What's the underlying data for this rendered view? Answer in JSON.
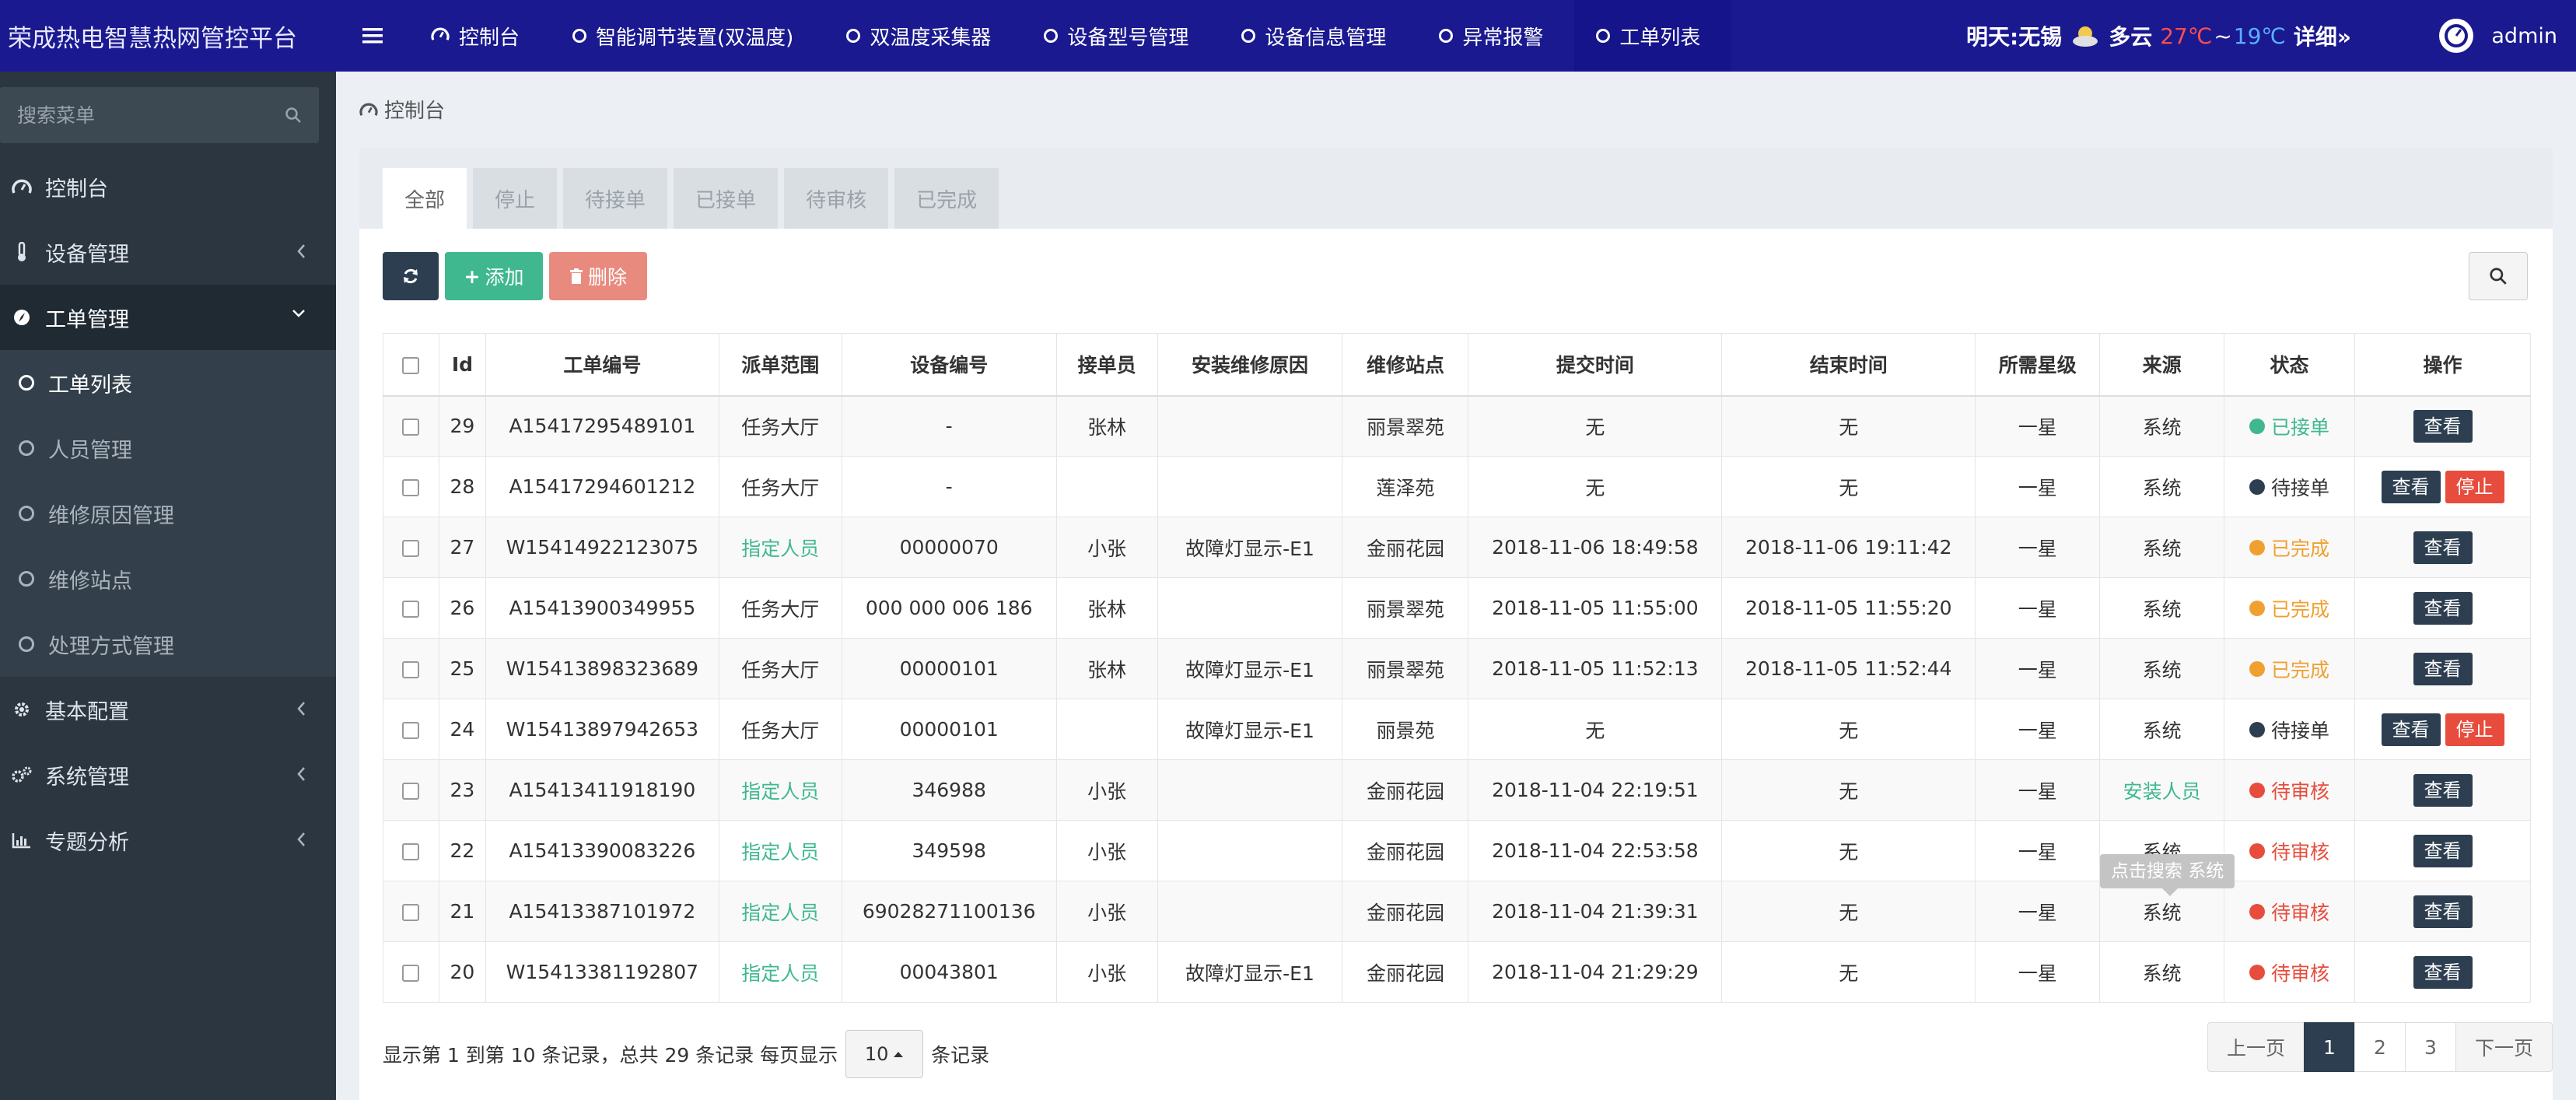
{
  "app": {
    "title": "荣成热电智慧热网管控平台"
  },
  "topnav": [
    {
      "label": "控制台",
      "icon": "dashboard-icon"
    },
    {
      "label": "智能调节装置(双温度)",
      "icon": "circle-icon"
    },
    {
      "label": "双温度采集器",
      "icon": "circle-icon"
    },
    {
      "label": "设备型号管理",
      "icon": "circle-icon"
    },
    {
      "label": "设备信息管理",
      "icon": "circle-icon"
    },
    {
      "label": "异常报警",
      "icon": "circle-icon"
    },
    {
      "label": "工单列表",
      "icon": "circle-icon"
    }
  ],
  "weather": {
    "prefix": "明天:",
    "city": "无锡",
    "condition": "多云",
    "high": "27℃",
    "tilde": "~",
    "low": "19℃",
    "detail": "详细»"
  },
  "user": {
    "name": "admin"
  },
  "sidebar": {
    "search_placeholder": "搜索菜单",
    "items": [
      {
        "label": "控制台",
        "icon": "dashboard-icon"
      },
      {
        "label": "设备管理",
        "icon": "thermometer-icon"
      },
      {
        "label": "工单管理",
        "icon": "compass-icon"
      },
      {
        "label": "基本配置",
        "icon": "gear-icon"
      },
      {
        "label": "系统管理",
        "icon": "cogs-icon"
      },
      {
        "label": "专题分析",
        "icon": "bar-chart-icon"
      }
    ],
    "subitems": [
      {
        "label": "工单列表"
      },
      {
        "label": "人员管理"
      },
      {
        "label": "维修原因管理"
      },
      {
        "label": "维修站点"
      },
      {
        "label": "处理方式管理"
      }
    ]
  },
  "breadcrumb": {
    "label": "控制台"
  },
  "tabs": [
    "全部",
    "停止",
    "待接单",
    "已接单",
    "待审核",
    "已完成"
  ],
  "toolbar": {
    "add_label": "添加",
    "delete_label": "删除"
  },
  "table": {
    "headers": [
      "Id",
      "工单编号",
      "派单范围",
      "设备编号",
      "接单员",
      "安装维修原因",
      "维修站点",
      "提交时间",
      "结束时间",
      "所需星级",
      "来源",
      "状态",
      "操作"
    ],
    "rows": [
      {
        "id": "29",
        "no": "A15417295489101",
        "scope": "任务大厅",
        "device": "-",
        "worker": "张林",
        "reason": "",
        "station": "丽景翠苑",
        "submit": "无",
        "end": "无",
        "star": "一星",
        "source": "系统",
        "status": "已接单",
        "view": "查看",
        "stop": ""
      },
      {
        "id": "28",
        "no": "A15417294601212",
        "scope": "任务大厅",
        "device": "-",
        "worker": "",
        "reason": "",
        "station": "莲泽苑",
        "submit": "无",
        "end": "无",
        "star": "一星",
        "source": "系统",
        "status": "待接单",
        "view": "查看",
        "stop": "停止"
      },
      {
        "id": "27",
        "no": "W15414922123075",
        "scope": "指定人员",
        "device": "00000070",
        "worker": "小张",
        "reason": "故障灯显示-E1",
        "station": "金丽花园",
        "submit": "2018-11-06 18:49:58",
        "end": "2018-11-06 19:11:42",
        "star": "一星",
        "source": "系统",
        "status": "已完成",
        "view": "查看",
        "stop": ""
      },
      {
        "id": "26",
        "no": "A15413900349955",
        "scope": "任务大厅",
        "device": "000 000 006 186",
        "worker": "张林",
        "reason": "",
        "station": "丽景翠苑",
        "submit": "2018-11-05 11:55:00",
        "end": "2018-11-05 11:55:20",
        "star": "一星",
        "source": "系统",
        "status": "已完成",
        "view": "查看",
        "stop": ""
      },
      {
        "id": "25",
        "no": "W15413898323689",
        "scope": "任务大厅",
        "device": "00000101",
        "worker": "张林",
        "reason": "故障灯显示-E1",
        "station": "丽景翠苑",
        "submit": "2018-11-05 11:52:13",
        "end": "2018-11-05 11:52:44",
        "star": "一星",
        "source": "系统",
        "status": "已完成",
        "view": "查看",
        "stop": ""
      },
      {
        "id": "24",
        "no": "W15413897942653",
        "scope": "任务大厅",
        "device": "00000101",
        "worker": "",
        "reason": "故障灯显示-E1",
        "station": "丽景苑",
        "submit": "无",
        "end": "无",
        "star": "一星",
        "source": "系统",
        "status": "待接单",
        "view": "查看",
        "stop": "停止"
      },
      {
        "id": "23",
        "no": "A15413411918190",
        "scope": "指定人员",
        "device": "346988",
        "worker": "小张",
        "reason": "",
        "station": "金丽花园",
        "submit": "2018-11-04 22:19:51",
        "end": "无",
        "star": "一星",
        "source": "安装人员",
        "status": "待审核",
        "view": "查看",
        "stop": ""
      },
      {
        "id": "22",
        "no": "A15413390083226",
        "scope": "指定人员",
        "device": "349598",
        "worker": "小张",
        "reason": "",
        "station": "金丽花园",
        "submit": "2018-11-04 22:53:58",
        "end": "无",
        "star": "一星",
        "source": "系统",
        "status": "待审核",
        "view": "查看",
        "stop": ""
      },
      {
        "id": "21",
        "no": "A15413387101972",
        "scope": "指定人员",
        "device": "69028271100136",
        "worker": "小张",
        "reason": "",
        "station": "金丽花园",
        "submit": "2018-11-04 21:39:31",
        "end": "无",
        "star": "一星",
        "source": "系统",
        "status": "待审核",
        "view": "查看",
        "stop": ""
      },
      {
        "id": "20",
        "no": "W15413381192807",
        "scope": "指定人员",
        "device": "00043801",
        "worker": "小张",
        "reason": "故障灯显示-E1",
        "station": "金丽花园",
        "submit": "2018-11-04 21:29:29",
        "end": "无",
        "star": "一星",
        "source": "系统",
        "status": "待审核",
        "view": "查看",
        "stop": ""
      }
    ]
  },
  "tooltip": {
    "text": "点击搜索 系统"
  },
  "status_colors": {
    "已接单": "#3fb88f",
    "待接单": "#2c3e50",
    "已完成": "#f0a030",
    "待审核": "#e74c3c"
  },
  "pagination_info": {
    "text": "显示第 1 到第 10 条记录，总共 29 条记录 每页显示",
    "page_size": "10",
    "suffix": "条记录"
  },
  "pagination": {
    "prev": "上一页",
    "pages": [
      "1",
      "2",
      "3"
    ],
    "next": "下一页",
    "active": "1"
  }
}
